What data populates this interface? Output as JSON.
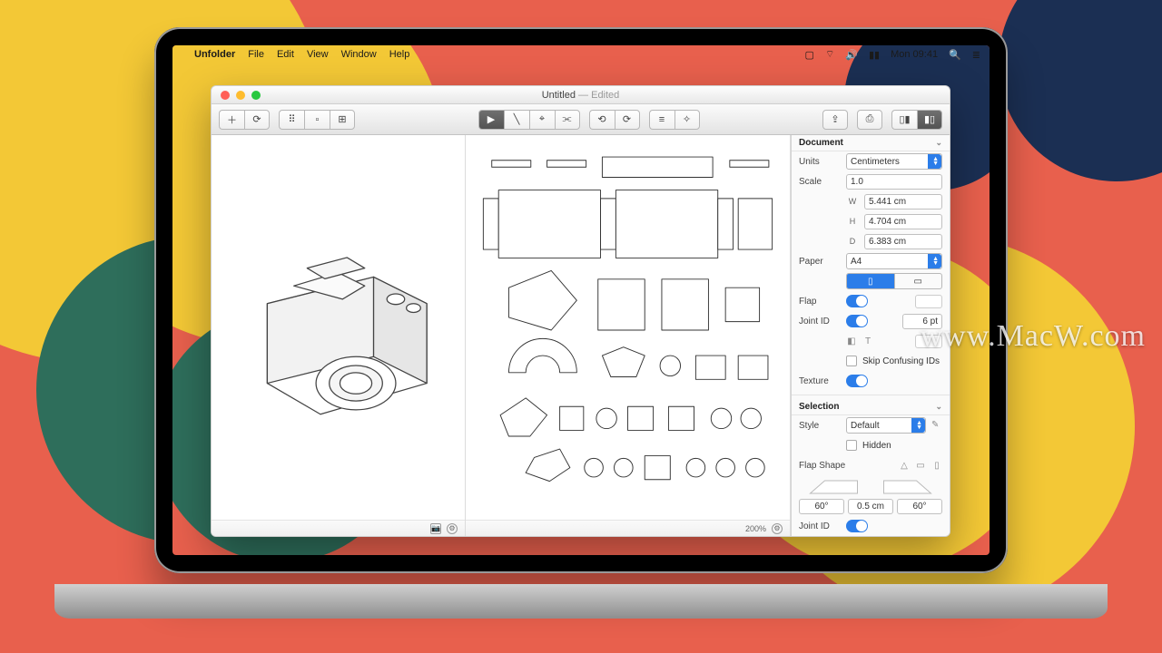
{
  "menubar": {
    "apple": "",
    "app_name": "Unfolder",
    "items": [
      "File",
      "Edit",
      "View",
      "Window",
      "Help"
    ],
    "clock": "Mon 09:41"
  },
  "window": {
    "title_file": "Untitled",
    "title_state": "— Edited"
  },
  "viewport": {
    "zoom": "200%"
  },
  "inspector": {
    "document": {
      "header": "Document",
      "units_label": "Units",
      "units_value": "Centimeters",
      "scale_label": "Scale",
      "scale_value": "1.0",
      "w_key": "W",
      "w_value": "5.441 cm",
      "h_key": "H",
      "h_value": "4.704 cm",
      "d_key": "D",
      "d_value": "6.383 cm",
      "paper_label": "Paper",
      "paper_value": "A4",
      "flap_label": "Flap",
      "jointid_label": "Joint ID",
      "jointid_pt": "6 pt",
      "skip_ids": "Skip Confusing IDs",
      "texture_label": "Texture"
    },
    "selection": {
      "header": "Selection",
      "style_label": "Style",
      "style_value": "Default",
      "hidden_label": "Hidden",
      "flap_shape_label": "Flap Shape",
      "flap_angle_l": "60°",
      "flap_width": "0.5 cm",
      "flap_angle_r": "60°",
      "jointid_label": "Joint ID"
    }
  },
  "watermark": "www.MacW.com",
  "icons": {
    "plus": "＋",
    "refresh": "⟳",
    "grid_collapse": "⠿",
    "voxel": "▫",
    "grid": "⊞",
    "play": "▶",
    "line": "╲",
    "anchor": "⌖",
    "link": "⫘",
    "rotate_l": "⟲",
    "rotate_r": "⟳",
    "align": "≡",
    "magic": "✧",
    "share": "⇪",
    "print": "⎙",
    "panel_l": "▯▮",
    "panel_r": "▮▯",
    "camera": "📷",
    "gear": "⚙",
    "chev": "⌄",
    "portrait": "▯",
    "landscape": "▭",
    "palette": "◧",
    "tri": "△",
    "rect": "▭",
    "t": "T",
    "pencil": "✎"
  }
}
